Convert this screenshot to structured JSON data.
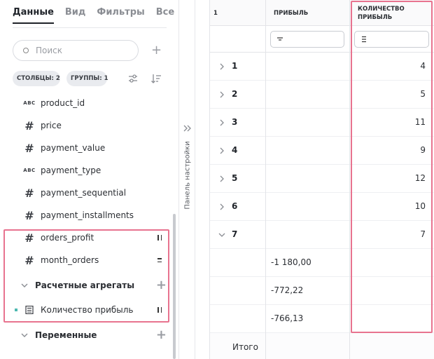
{
  "tabs": [
    "Данные",
    "Вид",
    "Фильтры",
    "Все"
  ],
  "search": {
    "placeholder": "Поиск"
  },
  "chips": {
    "columns": "СТОЛБЦЫ: 2",
    "groups": "ГРУППЫ: 1"
  },
  "fields": [
    {
      "type": "ABC",
      "name": "product_id"
    },
    {
      "type": "#",
      "name": "price"
    },
    {
      "type": "#",
      "name": "payment_value"
    },
    {
      "type": "ABC",
      "name": "payment_type"
    },
    {
      "type": "#",
      "name": "payment_sequential"
    },
    {
      "type": "#",
      "name": "payment_installments"
    },
    {
      "type": "#",
      "name": "orders_profit"
    },
    {
      "type": "#",
      "name": "month_orders"
    }
  ],
  "sections": {
    "calculated": "Расчетные агрегаты",
    "variables": "Переменные"
  },
  "calculated_items": [
    {
      "name": "Количество прибыль"
    }
  ],
  "settings_panel": {
    "label": "Панель настройки"
  },
  "table": {
    "headers": {
      "group": "1",
      "profit": "ПРИБЫЛЬ",
      "count": "КОЛИЧЕСТВО ПРИБЫЛЬ"
    },
    "rows": [
      {
        "key": "1",
        "count": "4"
      },
      {
        "key": "2",
        "count": "5"
      },
      {
        "key": "3",
        "count": "11"
      },
      {
        "key": "4",
        "count": "9"
      },
      {
        "key": "5",
        "count": "12"
      },
      {
        "key": "6",
        "count": "10"
      },
      {
        "key": "7",
        "count": "7"
      }
    ],
    "sub_rows": [
      {
        "profit": "-1 180,00"
      },
      {
        "profit": "-772,22"
      },
      {
        "profit": "-766,13"
      }
    ],
    "total_label": "Итого"
  },
  "colors": {
    "highlight": "#e8738f",
    "accent_dot": "#4cb8b0"
  }
}
